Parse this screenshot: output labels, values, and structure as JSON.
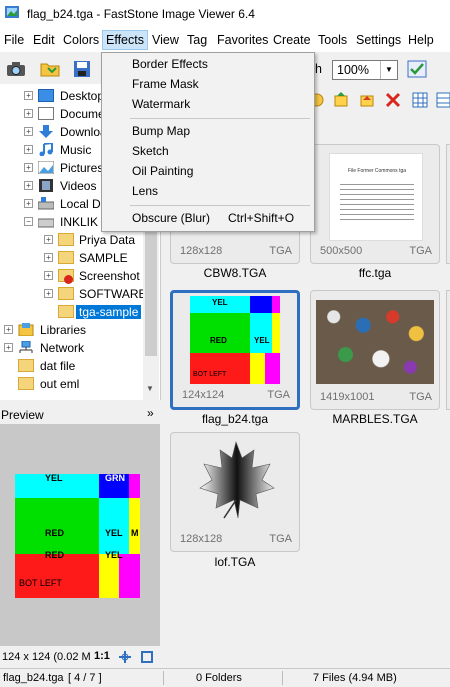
{
  "window": {
    "title": "flag_b24.tga  -  FastStone Image Viewer 6.4"
  },
  "menu": [
    "File",
    "Edit",
    "Colors",
    "Effects",
    "View",
    "Tag",
    "Favorites",
    "Create",
    "Tools",
    "Settings",
    "Help"
  ],
  "effects_menu": {
    "items": [
      "Border Effects",
      "Frame Mask",
      "Watermark",
      "Bump Map",
      "Sketch",
      "Oil Painting",
      "Lens",
      "Obscure (Blur)"
    ],
    "obscure_shortcut": "Ctrl+Shift+O"
  },
  "toolbar": {
    "zoom_value": "100%",
    "partial_label": "h"
  },
  "tree": {
    "items": [
      "Desktop",
      "Documents",
      "Downloads",
      "Music",
      "Pictures",
      "Videos",
      "Local Disk",
      "INKLIK (",
      "Priya Data",
      "SAMPLE",
      "Screenshot",
      "SOFTWARE",
      "tga-sample",
      "Libraries",
      "Network",
      "dat file",
      "out eml"
    ]
  },
  "preview": {
    "label": "Preview",
    "collapse_glyph": "»",
    "info": "124 x 124 (0.02 M",
    "ratio": "1:1"
  },
  "thumbnails": [
    {
      "name": "CBW8.TGA",
      "dims": "128x128",
      "type": "TGA"
    },
    {
      "name": "ffc.tga",
      "dims": "500x500",
      "type": "TGA",
      "text_title": "File Former Commons tga"
    },
    {
      "name": "flag_b24.tga",
      "dims": "124x124",
      "type": "TGA"
    },
    {
      "name": "MARBLES.TGA",
      "dims": "1419x1001",
      "type": "TGA"
    },
    {
      "name": "lof.TGA",
      "dims": "128x128",
      "type": "TGA"
    }
  ],
  "flag_labels": {
    "yel": "YEL",
    "red": "RED",
    "bot_left": "BOT LEFT",
    "m": "M",
    "grn": "GRN"
  },
  "status": {
    "file": "flag_b24.tga",
    "position": "[ 4 / 7 ]",
    "folders": "0 Folders",
    "files": "7 Files (4.94 MB)"
  },
  "colors": {
    "selection": "#0078d7",
    "thumb_select": "#2f6fbf",
    "menu_open": "#cce4f7"
  }
}
